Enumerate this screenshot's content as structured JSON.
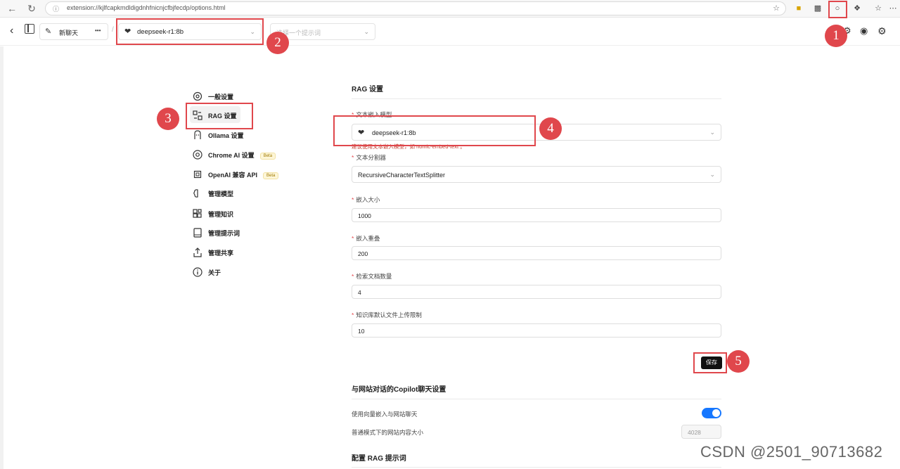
{
  "browser": {
    "url": "extension://kjlfcapkmdldigdnhfnicnjcfbjfecdp/options.html"
  },
  "header": {
    "new_chat_label": "新聊天",
    "more_label": "•••",
    "separator": "/",
    "model_value": "deepseek-r1:8b",
    "prompt_placeholder": "选择一个提示词"
  },
  "sidebar": {
    "items": [
      {
        "label": "一般设置",
        "icon": "gear-icon"
      },
      {
        "label": "RAG 设置",
        "icon": "rag-icon",
        "active": true
      },
      {
        "label": "Ollama 设置",
        "icon": "ollama-icon"
      },
      {
        "label": "Chrome AI 设置",
        "icon": "chrome-icon",
        "badge": "Beta"
      },
      {
        "label": "OpenAI 兼容 API",
        "icon": "chip-icon",
        "badge": "Beta"
      },
      {
        "label": "管理模型",
        "icon": "brain-icon"
      },
      {
        "label": "管理知识",
        "icon": "blocks-icon"
      },
      {
        "label": "管理提示词",
        "icon": "book-icon"
      },
      {
        "label": "管理共享",
        "icon": "share-icon"
      },
      {
        "label": "关于",
        "icon": "info-icon"
      }
    ]
  },
  "rag": {
    "title": "RAG 设置",
    "embedding_model": {
      "label": "文本嵌入模型",
      "value": "deepseek-r1:8b",
      "help": "建议使用文本嵌入模型，如 nomic-embed-text 。"
    },
    "splitter": {
      "label": "文本分割器",
      "value": "RecursiveCharacterTextSplitter"
    },
    "chunk_size": {
      "label": "嵌入大小",
      "value": "1000"
    },
    "chunk_overlap": {
      "label": "嵌入重叠",
      "value": "200"
    },
    "doc_count": {
      "label": "检索文档数量",
      "value": "4"
    },
    "upload_limit": {
      "label": "知识库默认文件上传限制",
      "value": "10"
    },
    "save_label": "保存"
  },
  "copilot": {
    "title": "与网站对话的Copilot聊天设置",
    "vector_toggle_label": "使用向量嵌入与网站聊天",
    "vector_toggle_on": true,
    "normal_mode_label": "普通模式下的网站内容大小",
    "normal_mode_value": "4028"
  },
  "rag_prompt": {
    "title": "配置 RAG 提示词"
  },
  "annotations": [
    "1",
    "2",
    "3",
    "4",
    "5"
  ],
  "watermark": "CSDN @2501_90713682",
  "colors": {
    "accent_red": "#e0474c",
    "toggle_blue": "#1677ff",
    "save_bg": "#111111"
  }
}
